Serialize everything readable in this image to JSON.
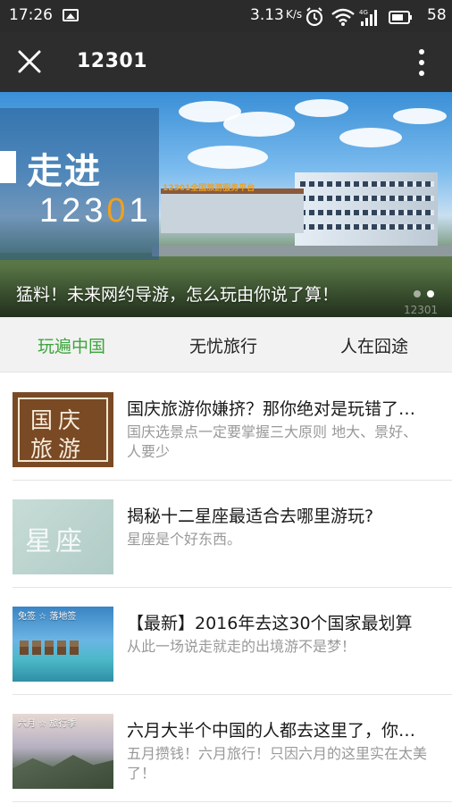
{
  "status_bar": {
    "time": "17:26",
    "net_speed": "3.13",
    "net_speed_unit": "K/s",
    "battery": "58",
    "icons": [
      "gallery-icon",
      "alarm-icon",
      "wifi-icon",
      "signal-4g-icon",
      "battery-icon"
    ]
  },
  "title_bar": {
    "title": "12301",
    "close_icon": "close-icon",
    "more_icon": "more-vertical-icon"
  },
  "banner": {
    "overlay_line1": "走进",
    "overlay_line2_a": "123",
    "overlay_line2_b": "0",
    "overlay_line2_c": "1",
    "sign_text": "12301全国旅游服务平台",
    "caption": "猛料！未来网约导游，怎么玩由你说了算！",
    "watermark": "12301",
    "pager_active_index": 1,
    "pager_count": 2
  },
  "tabs": [
    {
      "label": "玩遍中国",
      "active": true
    },
    {
      "label": "无忧旅行",
      "active": false
    },
    {
      "label": "人在囧途",
      "active": false
    }
  ],
  "articles": [
    {
      "title": "国庆旅游你嫌挤？那你绝对是玩错了地方",
      "desc": "国庆选景点一定要掌握三大原则 地大、景好、人要少",
      "thumb_line1": "国庆",
      "thumb_line2": "旅游"
    },
    {
      "title": "揭秘十二星座最适合去哪里游玩?",
      "desc": "星座是个好东西。",
      "thumb_text": "星座"
    },
    {
      "title": "【最新】2016年去这30个国家最划算",
      "desc": "从此一场说走就走的出境游不是梦！",
      "thumb_caption": "免签 ☆ 落地签"
    },
    {
      "title": "六月大半个中国的人都去这里了，你还在等什么",
      "desc": "五月攒钱！六月旅行！只因六月的这里实在太美了！",
      "thumb_caption": "六月 ☆ 旅行季"
    }
  ],
  "colors": {
    "status_bar_bg": "#2b2b2b",
    "title_bar_bg": "#2d2d2d",
    "tab_active": "#3ba53b",
    "tabs_bg": "#f2f2f2",
    "desc_text": "#999999"
  }
}
